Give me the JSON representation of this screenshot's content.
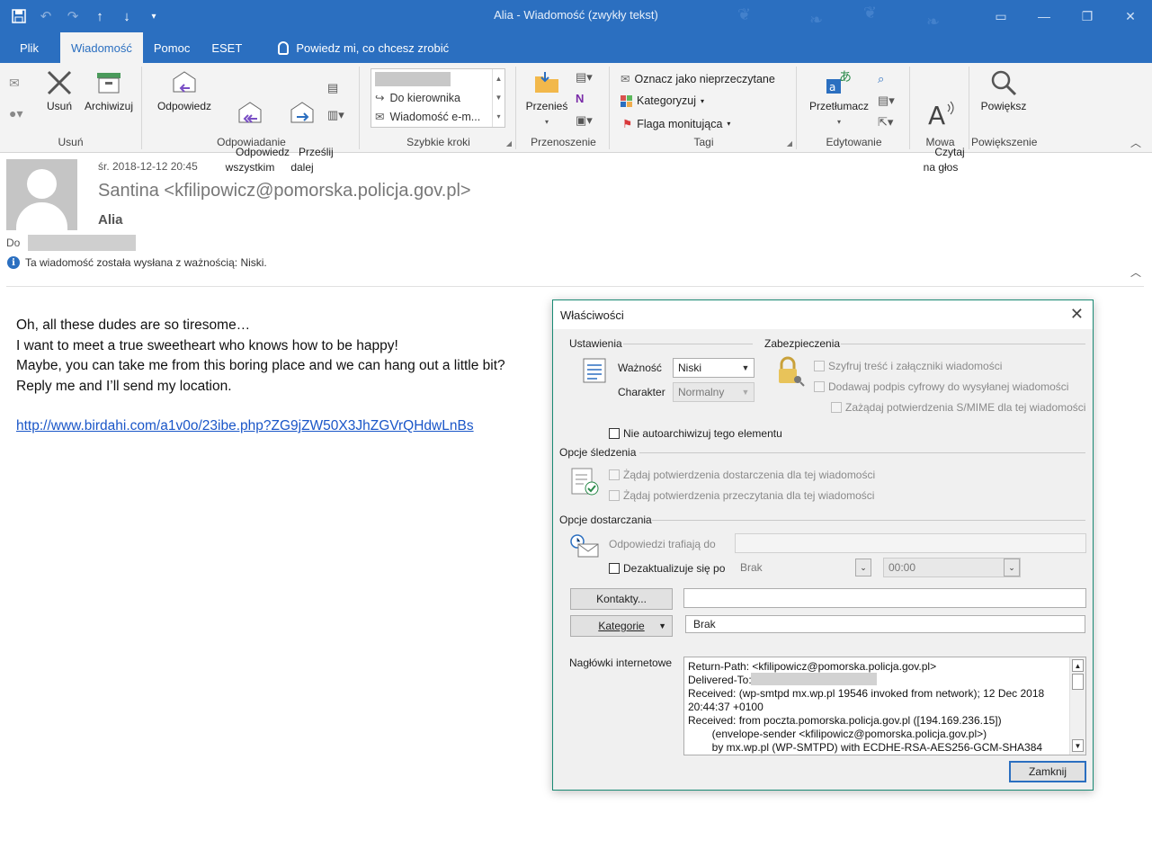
{
  "window": {
    "title": "Alia  -  Wiadomość (zwykły tekst)"
  },
  "menu": {
    "tabs": [
      "Plik",
      "Wiadomość",
      "Pomoc",
      "ESET"
    ],
    "tell_me": "Powiedz mi, co chcesz zrobić"
  },
  "ribbon": {
    "usun": {
      "delete": "Usuń",
      "archive": "Archiwizuj",
      "label": "Usuń"
    },
    "odpowiadanie": {
      "reply": "Odpowiedz",
      "reply_all": "Odpowiedz\nwszystkim",
      "forward": "Prześlij\ndalej",
      "label": "Odpowiadanie"
    },
    "szybkie_kroki": {
      "item1": "Do kierownika",
      "item2": "Wiadomość e-m...",
      "label": "Szybkie kroki"
    },
    "przenoszenie": {
      "move": "Przenieś",
      "label": "Przenoszenie"
    },
    "tagi": {
      "mark_unread": "Oznacz jako nieprzeczytane",
      "categorize": "Kategoryzuj",
      "follow_up": "Flaga monitująca",
      "label": "Tagi"
    },
    "edytowanie": {
      "translate": "Przetłumacz",
      "label": "Edytowanie"
    },
    "mowa": {
      "read_aloud": "Czytaj\nna głos",
      "label": "Mowa"
    },
    "powiekszenie": {
      "zoom": "Powiększ",
      "label": "Powiększenie"
    }
  },
  "message": {
    "date": "śr. 2018-12-12 20:45",
    "from": "Santina <kfilipowicz@pomorska.policja.gov.pl>",
    "subject": "Alia",
    "to_label": "Do",
    "info": "Ta wiadomość została wysłana z ważnością: Niski.",
    "body_lines": [
      "Oh, all these dudes are so tiresome…",
      "I want to meet a true sweetheart who knows how to be happy!",
      "Maybe, you can take me from this boring place and we can hang out a little bit?",
      "Reply me and I’ll send my location."
    ],
    "link": "http://www.birdahi.com/a1v0o/23ibe.php?ZG9jZW50X3JhZGVrQHdwLnBs"
  },
  "dialog": {
    "title": "Właściwości",
    "settings_label": "Ustawienia",
    "security_label": "Zabezpieczenia",
    "importance_label": "Ważność",
    "importance_value": "Niski",
    "sensitivity_label": "Charakter",
    "sensitivity_value": "Normalny",
    "encrypt": "Szyfruj treść i załączniki wiadomości",
    "sign": "Dodawaj podpis cyfrowy do wysyłanej wiadomości",
    "smime": "Zażądaj potwierdzenia S/MIME dla tej wiadomości",
    "no_autoarchive": "Nie autoarchiwizuj tego elementu",
    "tracking_label": "Opcje śledzenia",
    "delivery_receipt": "Żądaj potwierdzenia dostarczenia dla tej wiadomości",
    "read_receipt": "Żądaj potwierdzenia przeczytania dla tej wiadomości",
    "delivery_label": "Opcje dostarczania",
    "replies_to": "Odpowiedzi trafiają do",
    "expires": "Dezaktualizuje się po",
    "expires_date": "Brak",
    "expires_time": "00:00",
    "contacts_btn": "Kontakty...",
    "categories_btn": "Kategorie",
    "categories_value": "Brak",
    "headers_label": "Nagłówki internetowe",
    "headers_text": "Return-Path: <kfilipowicz@pomorska.policja.gov.pl>\nDelivered-To:\nReceived: (wp-smtpd mx.wp.pl 19546 invoked from network); 12 Dec 2018\n20:44:37 +0100\nReceived: from poczta.pomorska.policja.gov.pl ([194.169.236.15])\n        (envelope-sender <kfilipowicz@pomorska.policja.gov.pl>)\n        by mx.wp.pl (WP-SMTPD) with ECDHE-RSA-AES256-GCM-SHA384",
    "close_btn": "Zamknij"
  }
}
